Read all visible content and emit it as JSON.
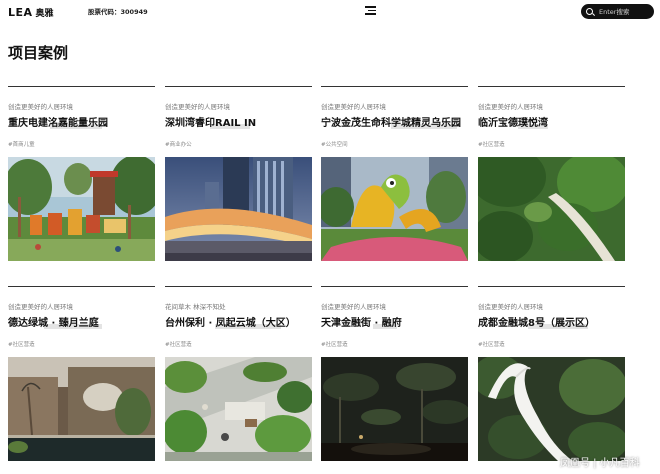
{
  "header": {
    "logo_mark": "LEA",
    "logo_cn": "奥雅",
    "stock_code": "股票代码：300949",
    "search_placeholder": "Enter搜索"
  },
  "page_title": "项目案例",
  "projects": [
    {
      "tagline": "创造更美好的人居环境",
      "name": "重庆电建洺嘉能量乐园",
      "category": "#首商儿童",
      "photo": "playground-icon"
    },
    {
      "tagline": "创造更美好的人居环境",
      "name": "深圳湾睿印RAIL IN",
      "category": "#商业办公",
      "photo": "mall-icon"
    },
    {
      "tagline": "创造更美好的人居环境",
      "name": "宁波金茂生命科学城精灵乌乐园",
      "category": "#公共空间",
      "photo": "sculpture-icon"
    },
    {
      "tagline": "创造更美好的人居环境",
      "name": "临沂宝德璞悦湾",
      "category": "#社区营造",
      "photo": "garden-path-icon"
    },
    {
      "tagline": "创造更美好的人居环境",
      "name": "德达绿城 · 臻月兰庭",
      "category": "#社区营造",
      "photo": "waterfront-icon"
    },
    {
      "tagline": "花间草木 林深不知处",
      "name": "台州保利 · 凤起云城（大区）",
      "category": "#社区营造",
      "photo": "plaza-icon"
    },
    {
      "tagline": "创造更美好的人居环境",
      "name": "天津金融街 · 融府",
      "category": "#社区营造",
      "photo": "night-garden-icon"
    },
    {
      "tagline": "创造更美好的人居环境",
      "name": "成都金融城8号（展示区）",
      "category": "#社区营造",
      "photo": "white-bridge-icon"
    }
  ],
  "watermark": "凤凰号 | 小凡百科"
}
